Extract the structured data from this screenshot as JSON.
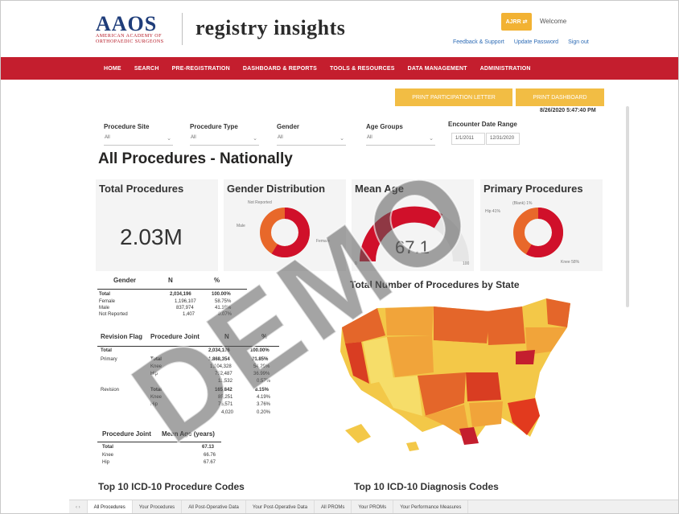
{
  "header": {
    "aaos_logo_big": "AAOS",
    "aaos_logo_small": "American Academy of Orthopaedic Surgeons",
    "registry_logo": "registry insights",
    "ajrr_button": "AJRR ⇄",
    "welcome": "Welcome",
    "links": [
      "Feedback & Support",
      "Update Password",
      "Sign out"
    ]
  },
  "nav": {
    "items": [
      "HOME",
      "SEARCH",
      "PRE-REGISTRATION",
      "DASHBOARD & REPORTS",
      "TOOLS & RESOURCES",
      "DATA MANAGEMENT",
      "ADMINISTRATION"
    ]
  },
  "actions": {
    "print_letter": "PRINT PARTICIPATION LETTER",
    "print_dashboard": "PRINT DASHBOARD",
    "timestamp": "8/26/2020 5:47:40 PM"
  },
  "filters": {
    "procedure_site": {
      "label": "Procedure Site",
      "value": "All"
    },
    "procedure_type": {
      "label": "Procedure Type",
      "value": "All"
    },
    "gender": {
      "label": "Gender",
      "value": "All"
    },
    "age_groups": {
      "label": "Age Groups",
      "value": "All"
    },
    "date_range": {
      "label": "Encounter Date Range",
      "start": "1/1/2011",
      "end": "12/31/2020"
    }
  },
  "page_title": "All Procedures - Nationally",
  "cards": {
    "total": {
      "title": "Total Procedures",
      "value": "2.03M"
    },
    "gender": {
      "title": "Gender Distribution",
      "labels": [
        "Not Reported",
        "Male",
        "Female"
      ]
    },
    "mean_age": {
      "title": "Mean Age",
      "value": "67.1",
      "min": "0",
      "max": "100"
    },
    "primary": {
      "title": "Primary Procedures",
      "labels": [
        "(Blank) 1%",
        "Hip 41%",
        "Knee 58%"
      ]
    }
  },
  "gender_table": {
    "headers": [
      "Gender",
      "N",
      "%"
    ],
    "rows": [
      [
        "Total",
        "2,034,196",
        "100.00%"
      ],
      [
        "Female",
        "1,196,107",
        "58.75%"
      ],
      [
        "Male",
        "837,974",
        "41.18%"
      ],
      [
        "Not Reported",
        "1,407",
        "0.07%"
      ]
    ]
  },
  "revision_table": {
    "headers": [
      "Revision Flag",
      "Procedure Joint",
      "N",
      "%"
    ],
    "rows": [
      [
        "Total",
        "",
        "2,034,196",
        "100.00%"
      ],
      [
        "Primary",
        "Total",
        "1,868,354",
        "91.85%"
      ],
      [
        "",
        "Knee",
        "1,104,328",
        "54.29%"
      ],
      [
        "",
        "Hip",
        "752,487",
        "36.99%"
      ],
      [
        "",
        "",
        "11,532",
        "0.57%"
      ],
      [
        "Revision",
        "Total",
        "165,842",
        "8.15%"
      ],
      [
        "",
        "Knee",
        "85,251",
        "4.19%"
      ],
      [
        "",
        "Hip",
        "76,571",
        "3.76%"
      ],
      [
        "",
        "",
        "4,020",
        "0.20%"
      ]
    ]
  },
  "age_table": {
    "headers": [
      "Procedure Joint",
      "Mean Age (years)"
    ],
    "rows": [
      [
        "Total",
        "67.13"
      ],
      [
        "Knee",
        "66.76"
      ],
      [
        "Hip",
        "67.67"
      ]
    ]
  },
  "map_title": "Total Number of Procedures by State",
  "icd_procedure_title": "Top 10 ICD-10 Procedure Codes",
  "icd_diagnosis_title": "Top 10 ICD-10 Diagnosis Codes",
  "tabs": [
    "All Procedures",
    "Your Procedures",
    "All Post-Operative Data",
    "Your Post-Operative Data",
    "All PROMs",
    "Your PROMs",
    "Your Performance Measures"
  ],
  "watermark": "DEMO",
  "colors": {
    "nav_red": "#c41e2e",
    "accent_yellow": "#f2bd44",
    "donut_red": "#d0102a",
    "donut_orange": "#e8682a"
  }
}
